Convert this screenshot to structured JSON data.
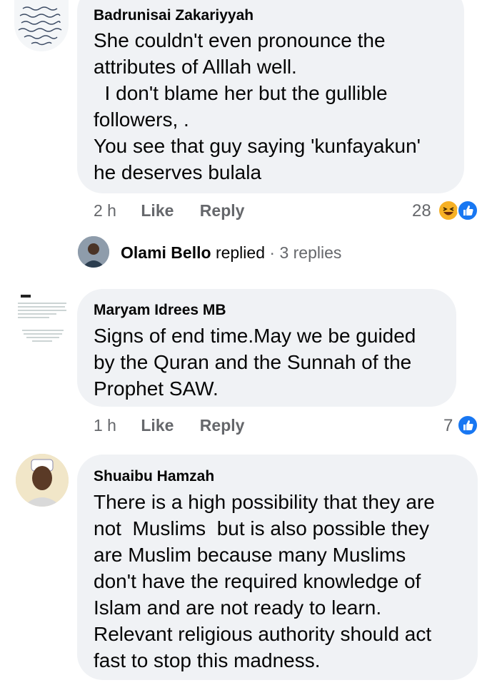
{
  "comments": [
    {
      "author": "Badrunisai Zakariyyah",
      "lines": [
        "She couldn't even pronounce the",
        "attributes of Alllah well.",
        "  I don't blame her but the gullible",
        "followers, .",
        "You see that guy saying 'kunfayakun'",
        "he deserves bulala"
      ],
      "time": "2 h",
      "like_label": "Like",
      "reply_label": "Reply",
      "reaction_count": "28",
      "reactions": [
        "haha-icon",
        "like-icon"
      ]
    },
    {
      "author": "Maryam Idrees MB",
      "lines": [
        "Signs of end time.May we be guided",
        "by the Quran and the Sunnah of the",
        "Prophet SAW."
      ],
      "time": "1 h",
      "like_label": "Like",
      "reply_label": "Reply",
      "reaction_count": "7",
      "reactions": [
        "like-icon"
      ]
    },
    {
      "author": "Shuaibu Hamzah",
      "lines": [
        "There is a high possibility that they are",
        "not  Muslims  but is also possible they",
        "are Muslim because many Muslims",
        "don't have the required knowledge of",
        "Islam and are not ready to learn.",
        "Relevant religious authority should act",
        "fast to stop this madness."
      ]
    }
  ],
  "replies_summary": {
    "name": "Olami Bello",
    "verb": "replied",
    "separator": "·",
    "count": "3 replies"
  },
  "colors": {
    "bubble": "#f0f2f5",
    "meta": "#65676b",
    "like_blue": "#1877f2",
    "haha_yellow": "#f7b125"
  }
}
